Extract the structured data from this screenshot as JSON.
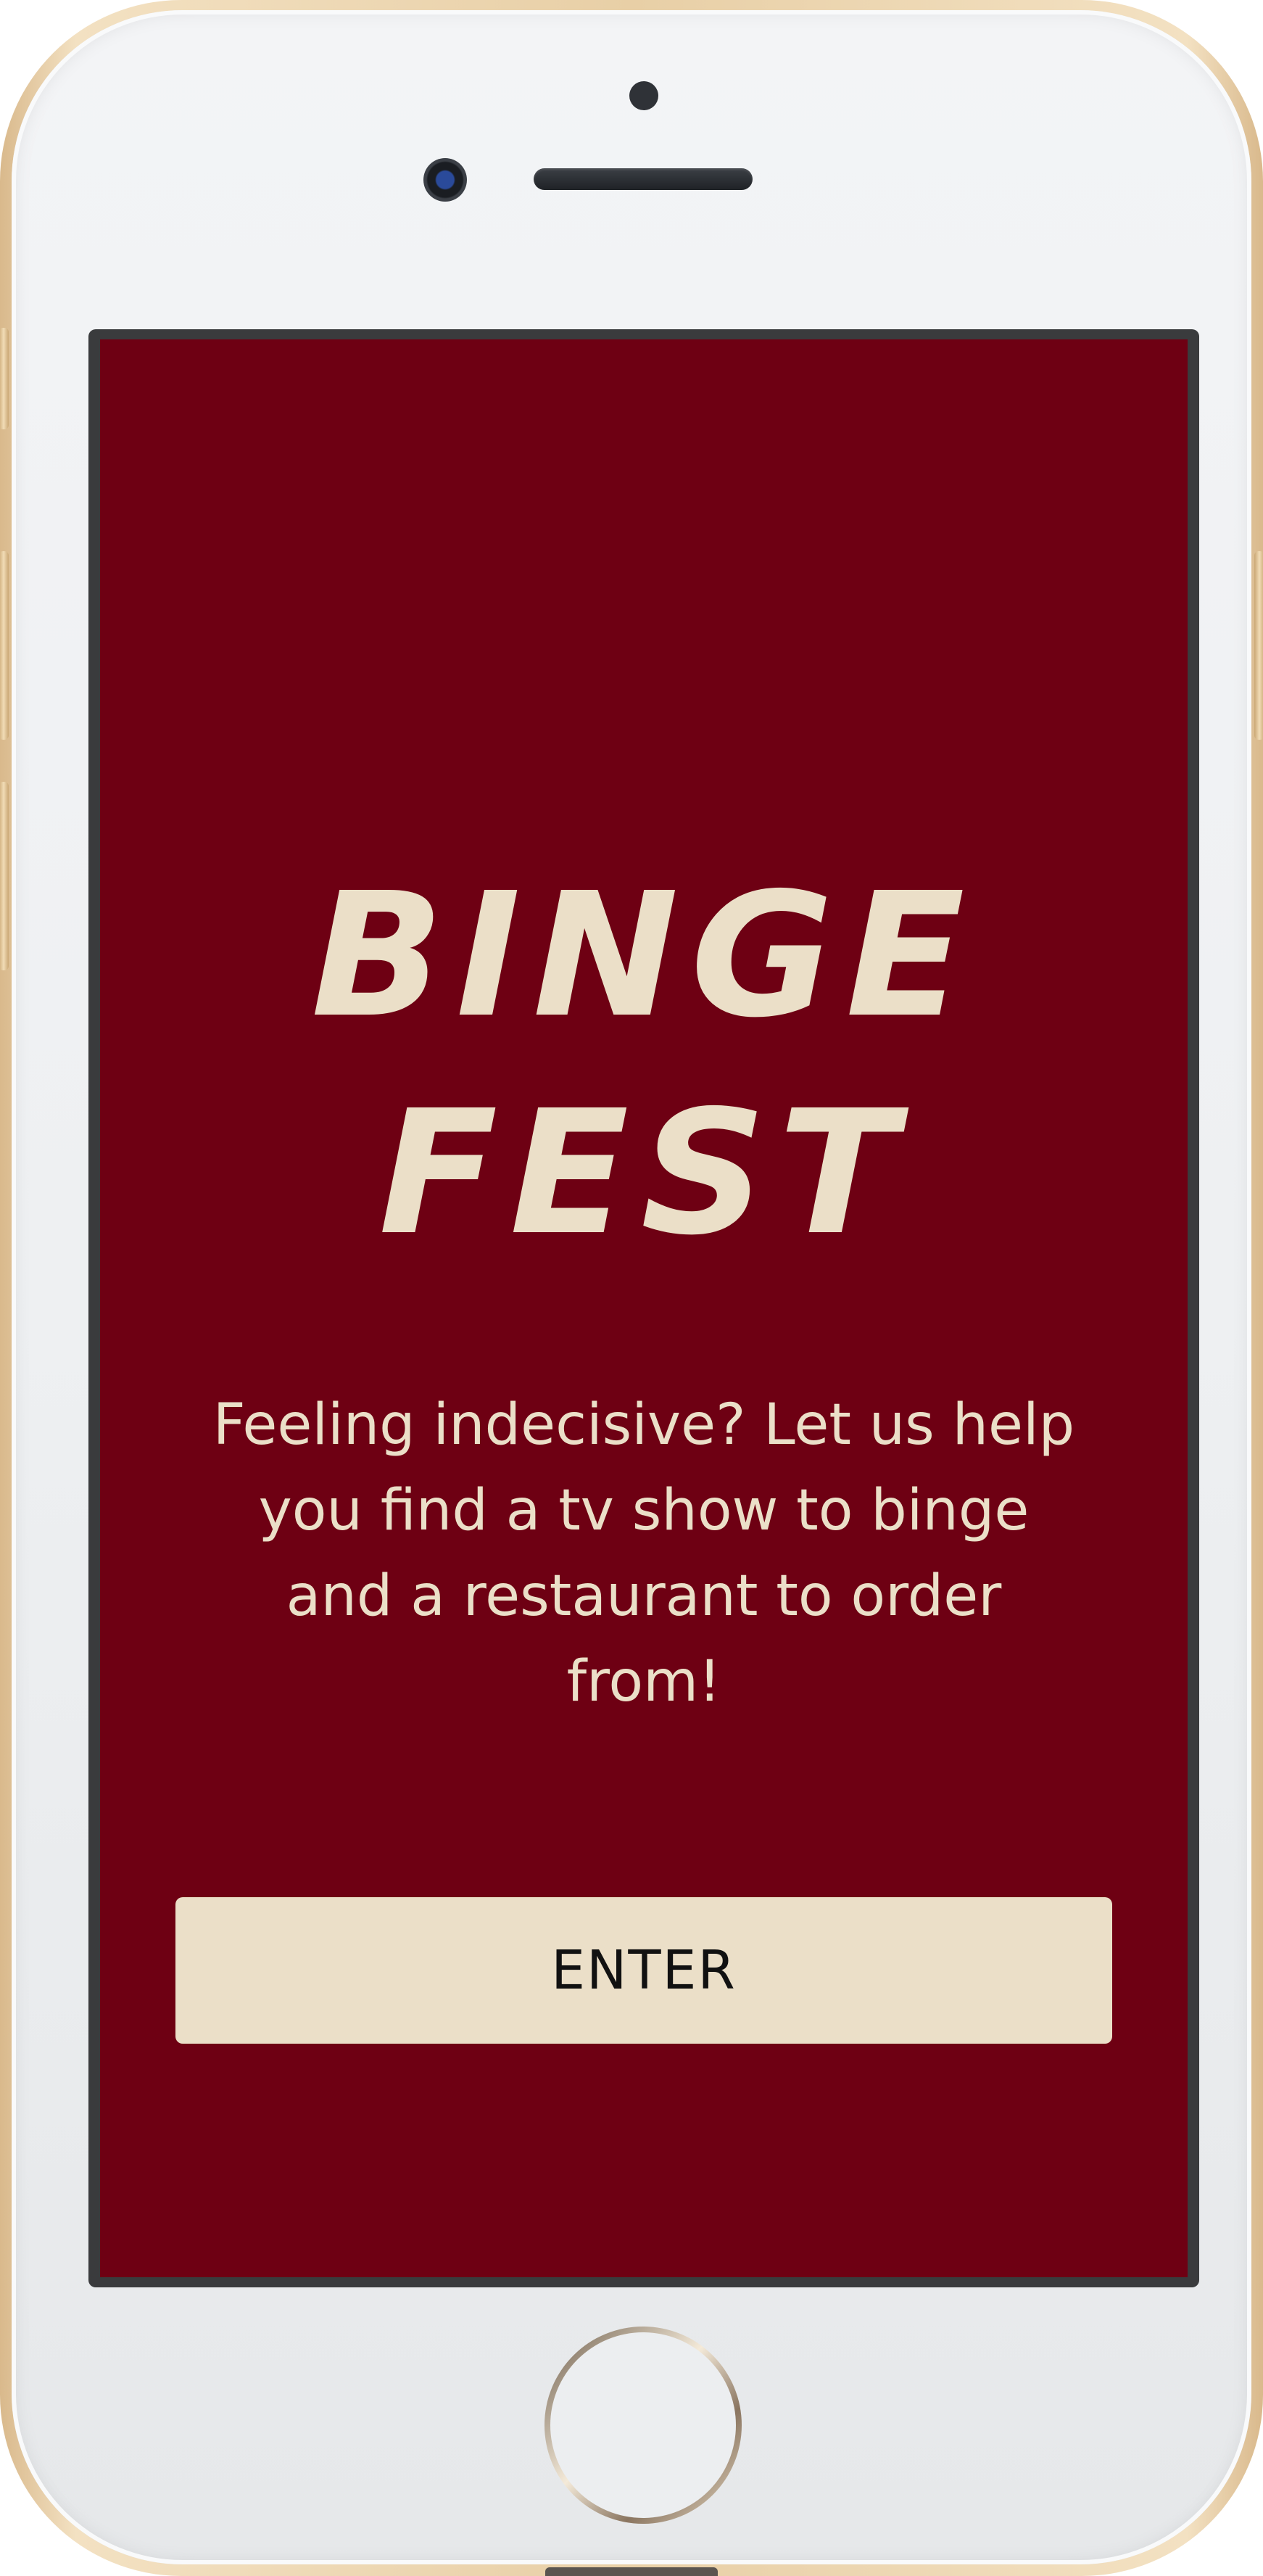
{
  "app": {
    "title_line1": "BINGE",
    "title_line2": "FEST",
    "tagline": "Feeling indecisive? Let us help you find a tv show to binge and a restaurant to order from!",
    "enter_label": "ENTER"
  },
  "colors": {
    "background": "#6e0013",
    "accent": "#ebdfc8",
    "button_text": "#111111"
  },
  "device": {
    "model_icon": "iphone-frame"
  }
}
